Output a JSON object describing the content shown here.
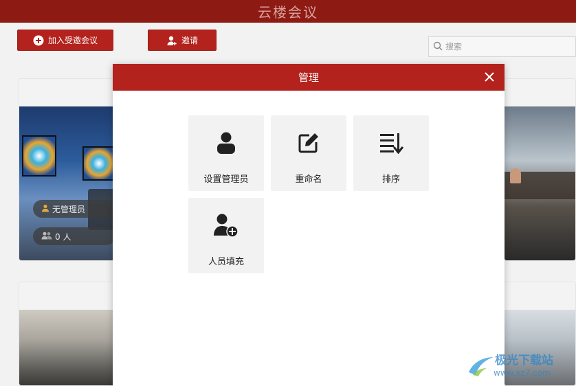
{
  "window": {
    "title": "云楼会议"
  },
  "toolbar": {
    "join_label": "加入受邀会议",
    "invite_label": "邀请",
    "join_icon": "plus-circle-icon",
    "invite_icon": "add-user-icon"
  },
  "search": {
    "placeholder": "搜索",
    "value": ""
  },
  "rooms": [
    {
      "admin_label": "无管理员",
      "member_count": "0 人"
    }
  ],
  "modal": {
    "title": "管理",
    "close_icon": "close-icon",
    "actions": [
      {
        "label": "设置管理员",
        "icon": "user-icon"
      },
      {
        "label": "重命名",
        "icon": "edit-icon"
      },
      {
        "label": "排序",
        "icon": "sort-icon"
      },
      {
        "label": "人员填充",
        "icon": "user-add-icon"
      }
    ]
  },
  "watermark": {
    "text": "极光下载站",
    "url": "www.xz7.com"
  },
  "colors": {
    "brand": "#b3221c",
    "titlebar": "#8e1a14",
    "tile_bg": "#f2f2f2"
  }
}
